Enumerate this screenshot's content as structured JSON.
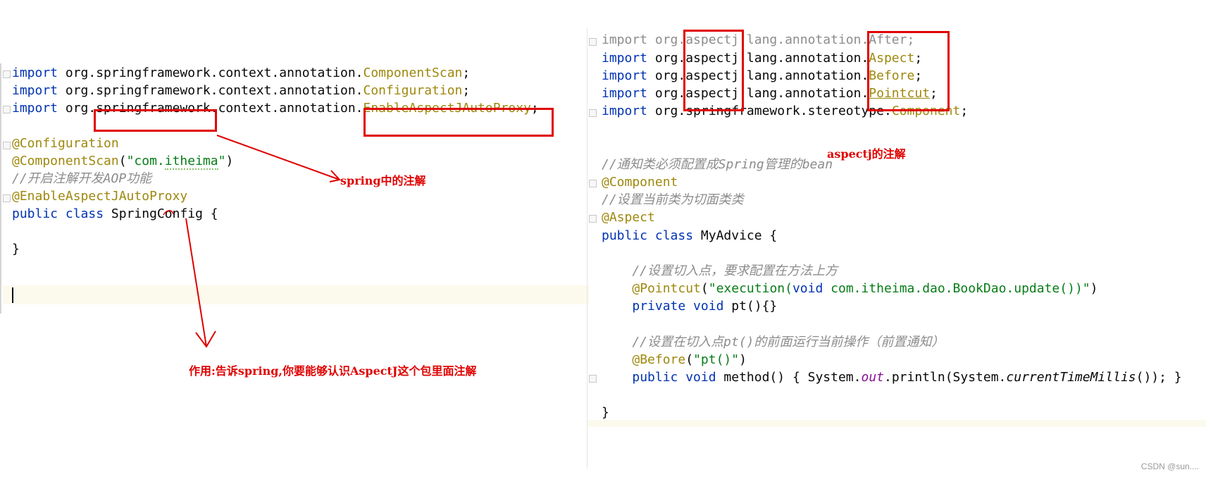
{
  "left_editor": {
    "lines": [
      "import org.springframework.context.annotation.ComponentScan;",
      "import org.springframework.context.annotation.Configuration;",
      "import org.springframework.context.annotation.EnableAspectJAutoProxy;",
      "",
      "@Configuration",
      "@ComponentScan(\"com.itheima\")",
      "//开启注解开发AOP功能",
      "@EnableAspectJAutoProxy",
      "public class SpringConfig {",
      "",
      "}",
      ""
    ]
  },
  "right_editor": {
    "lines": [
      "import org.aspectj.lang.annotation.After;",
      "import org.aspectj.lang.annotation.Aspect;",
      "import org.aspectj.lang.annotation.Before;",
      "import org.aspectj.lang.annotation.Pointcut;",
      "import org.springframework.stereotype.Component;",
      "",
      "",
      "//通知类必须配置成Spring管理的bean",
      "@Component",
      "//设置当前类为切面类类",
      "@Aspect",
      "public class MyAdvice {",
      "",
      "    //设置切入点，要求配置在方法上方",
      "    @Pointcut(\"execution(void com.itheima.dao.BookDao.update())\")",
      "    private void pt(){}",
      "",
      "    //设置在切入点pt()的前面运行当前操作（前置通知）",
      "    @Before(\"pt()\")",
      "    public void method() { System.out.println(System.currentTimeMillis()); }",
      "",
      "}"
    ]
  },
  "annotations": {
    "spring_label": "spring中的注解",
    "aspectj_label": "aspectj的注解",
    "purpose_label": "作用:告诉spring,你要能够认识AspectJ这个包里面注解"
  },
  "watermark": "CSDN @sun....",
  "colors": {
    "keyword": "#0033b3",
    "annotation": "#9e880d",
    "string": "#067d17",
    "comment": "#8c8c8c",
    "highlight_red": "#e00000"
  }
}
